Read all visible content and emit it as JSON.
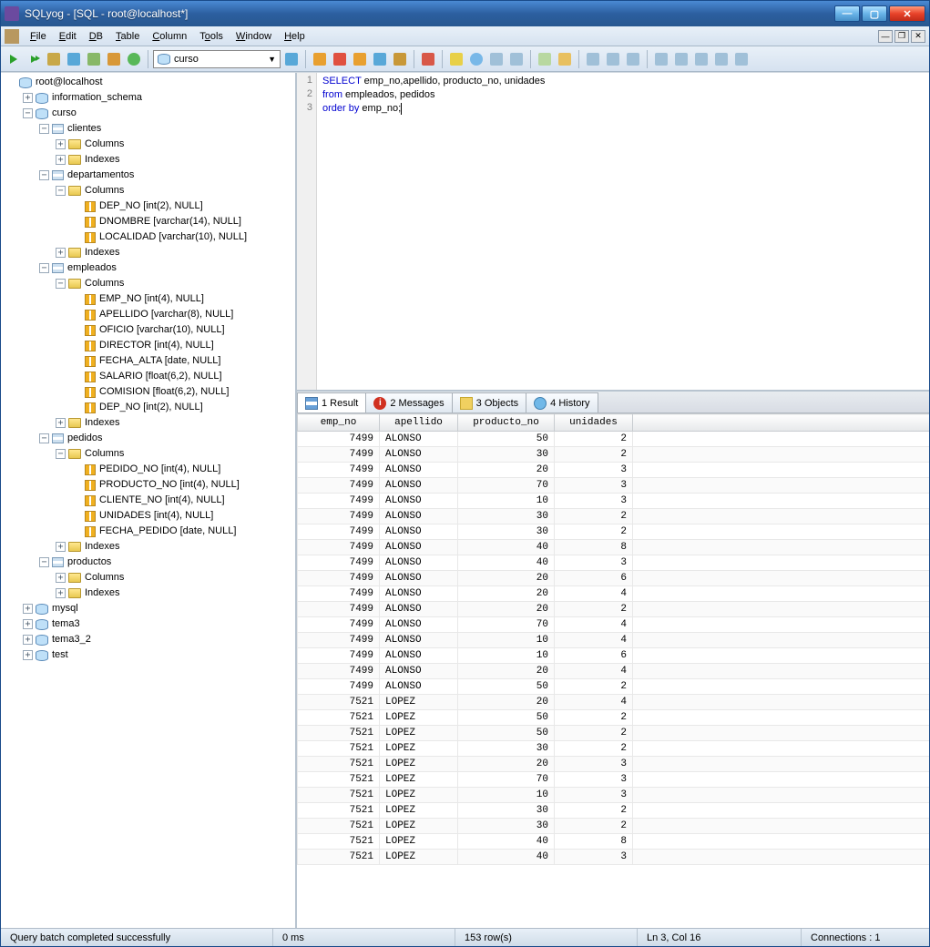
{
  "window": {
    "title": "SQLyog - [SQL - root@localhost*]"
  },
  "menu": {
    "file": "File",
    "edit": "Edit",
    "db": "DB",
    "table": "Table",
    "column": "Column",
    "tools": "Tools",
    "window": "Window",
    "help": "Help"
  },
  "toolbar": {
    "db_selected": "curso"
  },
  "tree": {
    "root": "root@localhost",
    "dbs": {
      "information_schema": "information_schema",
      "curso": "curso",
      "mysql": "mysql",
      "tema3": "tema3",
      "tema3_2": "tema3_2",
      "test": "test"
    },
    "folders": {
      "columns": "Columns",
      "indexes": "Indexes"
    },
    "tables": {
      "clientes": "clientes",
      "departamentos": "departamentos",
      "empleados": "empleados",
      "pedidos": "pedidos",
      "productos": "productos"
    },
    "cols": {
      "dep_no": "DEP_NO [int(2), NULL]",
      "dnombre": "DNOMBRE [varchar(14), NULL]",
      "localidad": "LOCALIDAD [varchar(10), NULL]",
      "emp_no": "EMP_NO [int(4), NULL]",
      "apellido": "APELLIDO [varchar(8), NULL]",
      "oficio": "OFICIO [varchar(10), NULL]",
      "director": "DIRECTOR [int(4), NULL]",
      "fecha_alta": "FECHA_ALTA [date, NULL]",
      "salario": "SALARIO [float(6,2), NULL]",
      "comision": "COMISION [float(6,2), NULL]",
      "e_dep_no": "DEP_NO [int(2), NULL]",
      "pedido_no": "PEDIDO_NO [int(4), NULL]",
      "producto_no": "PRODUCTO_NO [int(4), NULL]",
      "cliente_no": "CLIENTE_NO [int(4), NULL]",
      "unidades": "UNIDADES [int(4), NULL]",
      "fecha_pedido": "FECHA_PEDIDO [date, NULL]"
    }
  },
  "editor": {
    "lines": [
      "1",
      "2",
      "3"
    ],
    "l1_kw": "SELECT",
    "l1_rest": " emp_no,apellido, producto_no, unidades",
    "l2_kw": "from",
    "l2_rest": " empleados, pedidos",
    "l3_kw": "order by",
    "l3_rest": " emp_no;"
  },
  "tabs": {
    "result": "1 Result",
    "messages": "2 Messages",
    "objects": "3 Objects",
    "history": "4 History"
  },
  "grid": {
    "headers": {
      "emp_no": "emp_no",
      "apellido": "apellido",
      "producto_no": "producto_no",
      "unidades": "unidades"
    },
    "rows": [
      {
        "emp_no": "7499",
        "apellido": "ALONSO",
        "producto_no": "50",
        "unidades": "2"
      },
      {
        "emp_no": "7499",
        "apellido": "ALONSO",
        "producto_no": "30",
        "unidades": "2"
      },
      {
        "emp_no": "7499",
        "apellido": "ALONSO",
        "producto_no": "20",
        "unidades": "3"
      },
      {
        "emp_no": "7499",
        "apellido": "ALONSO",
        "producto_no": "70",
        "unidades": "3"
      },
      {
        "emp_no": "7499",
        "apellido": "ALONSO",
        "producto_no": "10",
        "unidades": "3"
      },
      {
        "emp_no": "7499",
        "apellido": "ALONSO",
        "producto_no": "30",
        "unidades": "2"
      },
      {
        "emp_no": "7499",
        "apellido": "ALONSO",
        "producto_no": "30",
        "unidades": "2"
      },
      {
        "emp_no": "7499",
        "apellido": "ALONSO",
        "producto_no": "40",
        "unidades": "8"
      },
      {
        "emp_no": "7499",
        "apellido": "ALONSO",
        "producto_no": "40",
        "unidades": "3"
      },
      {
        "emp_no": "7499",
        "apellido": "ALONSO",
        "producto_no": "20",
        "unidades": "6"
      },
      {
        "emp_no": "7499",
        "apellido": "ALONSO",
        "producto_no": "20",
        "unidades": "4"
      },
      {
        "emp_no": "7499",
        "apellido": "ALONSO",
        "producto_no": "20",
        "unidades": "2"
      },
      {
        "emp_no": "7499",
        "apellido": "ALONSO",
        "producto_no": "70",
        "unidades": "4"
      },
      {
        "emp_no": "7499",
        "apellido": "ALONSO",
        "producto_no": "10",
        "unidades": "4"
      },
      {
        "emp_no": "7499",
        "apellido": "ALONSO",
        "producto_no": "10",
        "unidades": "6"
      },
      {
        "emp_no": "7499",
        "apellido": "ALONSO",
        "producto_no": "20",
        "unidades": "4"
      },
      {
        "emp_no": "7499",
        "apellido": "ALONSO",
        "producto_no": "50",
        "unidades": "2"
      },
      {
        "emp_no": "7521",
        "apellido": "LOPEZ",
        "producto_no": "20",
        "unidades": "4"
      },
      {
        "emp_no": "7521",
        "apellido": "LOPEZ",
        "producto_no": "50",
        "unidades": "2"
      },
      {
        "emp_no": "7521",
        "apellido": "LOPEZ",
        "producto_no": "50",
        "unidades": "2"
      },
      {
        "emp_no": "7521",
        "apellido": "LOPEZ",
        "producto_no": "30",
        "unidades": "2"
      },
      {
        "emp_no": "7521",
        "apellido": "LOPEZ",
        "producto_no": "20",
        "unidades": "3"
      },
      {
        "emp_no": "7521",
        "apellido": "LOPEZ",
        "producto_no": "70",
        "unidades": "3"
      },
      {
        "emp_no": "7521",
        "apellido": "LOPEZ",
        "producto_no": "10",
        "unidades": "3"
      },
      {
        "emp_no": "7521",
        "apellido": "LOPEZ",
        "producto_no": "30",
        "unidades": "2"
      },
      {
        "emp_no": "7521",
        "apellido": "LOPEZ",
        "producto_no": "30",
        "unidades": "2"
      },
      {
        "emp_no": "7521",
        "apellido": "LOPEZ",
        "producto_no": "40",
        "unidades": "8"
      },
      {
        "emp_no": "7521",
        "apellido": "LOPEZ",
        "producto_no": "40",
        "unidades": "3"
      }
    ]
  },
  "status": {
    "msg": "Query batch completed successfully",
    "time": "0 ms",
    "rows": "153 row(s)",
    "pos": "Ln 3, Col 16",
    "conn": "Connections : 1"
  }
}
